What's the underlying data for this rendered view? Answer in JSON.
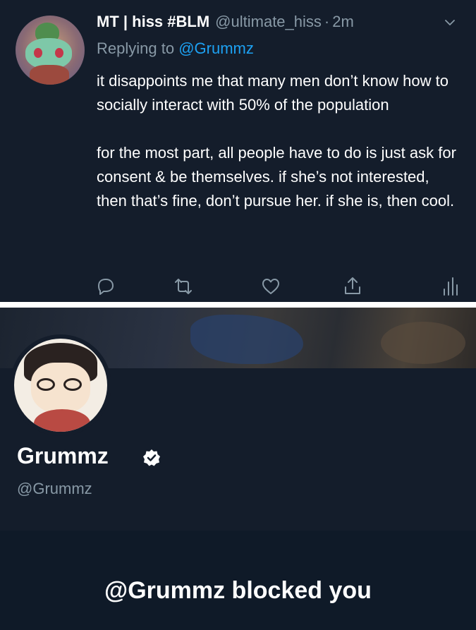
{
  "tweet": {
    "author_name": "MT | hiss #BLM",
    "author_handle": "@ultimate_hiss",
    "time_separator": "·",
    "time": "2m",
    "reply_prefix": "Replying to",
    "reply_mention": "@Grummz",
    "paragraphs": [
      "it disappoints me that many men don’t know how to socially interact with 50% of the population",
      "for the most part, all people have to do is just ask for consent & be themselves. if she’s not interested, then that’s fine, don’t pursue her. if she is, then cool."
    ],
    "actions": [
      "reply-icon",
      "retweet-icon",
      "like-icon",
      "share-icon",
      "analytics-icon"
    ]
  },
  "profile": {
    "name": "Grummz",
    "handle": "@Grummz",
    "verified": true,
    "blocked_message": "@Grummz blocked you"
  },
  "colors": {
    "background": "#141d2b",
    "secondary_text": "#8899a6",
    "link": "#1da1f2"
  }
}
